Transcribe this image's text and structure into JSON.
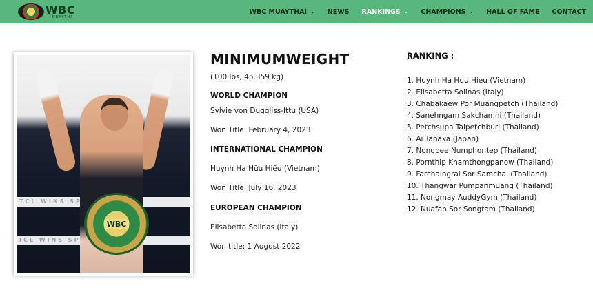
{
  "nav": {
    "logo_text": "WBC",
    "logo_sub": "MUAYTHAI",
    "items": [
      {
        "label": "WBC MUAYTHAI",
        "has_dropdown": true,
        "active": false
      },
      {
        "label": "NEWS",
        "has_dropdown": false,
        "active": false
      },
      {
        "label": "RANKINGS",
        "has_dropdown": true,
        "active": true
      },
      {
        "label": "CHAMPIONS",
        "has_dropdown": true,
        "active": false
      },
      {
        "label": "HALL OF FAME",
        "has_dropdown": false,
        "active": false
      },
      {
        "label": "CONTACT",
        "has_dropdown": false,
        "active": false
      }
    ],
    "chevron_icon": "chevron-down-icon",
    "bar_color": "#58b87c",
    "active_color": "#ffffff"
  },
  "photo": {
    "ring_banner_1": "TCL   WINS SPE",
    "ring_banner_2": "ICL   WINS SPE",
    "belt_text": "WBC"
  },
  "division": {
    "title": "MINIMUMWEIGHT",
    "weight": "(100 lbs, 45.359 kg)",
    "world_heading": "WORLD CHAMPION",
    "world_name": "Sylvie von Duggliss-Ittu (USA)",
    "world_won": "Won Title: February 4, 2023",
    "international_heading": "INTERNATIONAL CHAMPION",
    "international_name": "Huynh Ha Hữu Hiếu (Vietnam)",
    "international_won": "Won Title: July 16, 2023",
    "european_heading": "EUROPEAN CHAMPION",
    "european_name": "Elisabetta Solinas (Italy)",
    "european_won": "Won title: 1 August 2022"
  },
  "ranking": {
    "title": "RANKING :",
    "items": [
      "1. Huynh Ha Huu Hieu (Vietnam)",
      "2. Elisabetta Solinas (Italy)",
      "3. Chabakaew Por Muangpetch (Thailand)",
      "4. Sanehngam Sakchamni (Thailand)",
      "5. Petchsupa Taipetchburi (Thailand)",
      "6. Ai Tanaka (Japan)",
      "7. Nongpee Numphontep (Thailand)",
      "8. Pornthip Khamthongpanow (Thailand)",
      "9. Farchaingrai Sor Samchai (Thailand)",
      "10. Thangwar Pumpanmuang (Thailand)",
      "11. Nongmay AuddyGym (Thailand)",
      "12. Nuafah Sor Songtam (Thailand)"
    ]
  }
}
